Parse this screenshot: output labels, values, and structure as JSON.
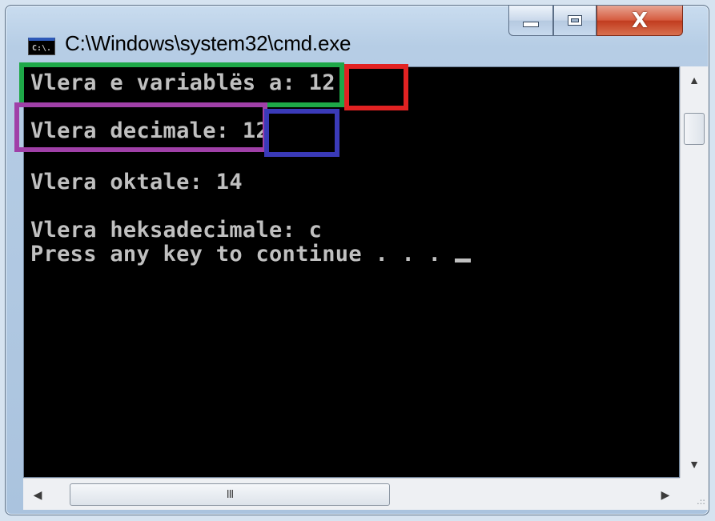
{
  "window": {
    "title": "C:\\Windows\\system32\\cmd.exe",
    "icon": "cmd-icon",
    "icon_text": "C:\\."
  },
  "controls": {
    "minimize_icon": "minimize-icon",
    "maximize_icon": "maximize-icon",
    "close_icon": "close-icon",
    "close_glyph": "X"
  },
  "console": {
    "lines": [
      {
        "label": "Vlera e variablës a:",
        "value": "12"
      },
      {
        "label": "Vlera decimale:",
        "value": "12"
      },
      {
        "label": "Vlera oktale:",
        "value": "14"
      },
      {
        "label": "Vlera heksadecimale:",
        "value": "c"
      }
    ],
    "prompt": "Press any key to continue . . . "
  },
  "highlights": {
    "colors": {
      "green": "#1ea848",
      "red": "#e22222",
      "purple": "#a040a8",
      "blue": "#3a3ab8"
    }
  },
  "scrollbars": {
    "up_glyph": "▲",
    "down_glyph": "▼",
    "left_glyph": "◀",
    "right_glyph": "▶",
    "hthumb_grip": "III",
    "resize_grip": ".::"
  }
}
